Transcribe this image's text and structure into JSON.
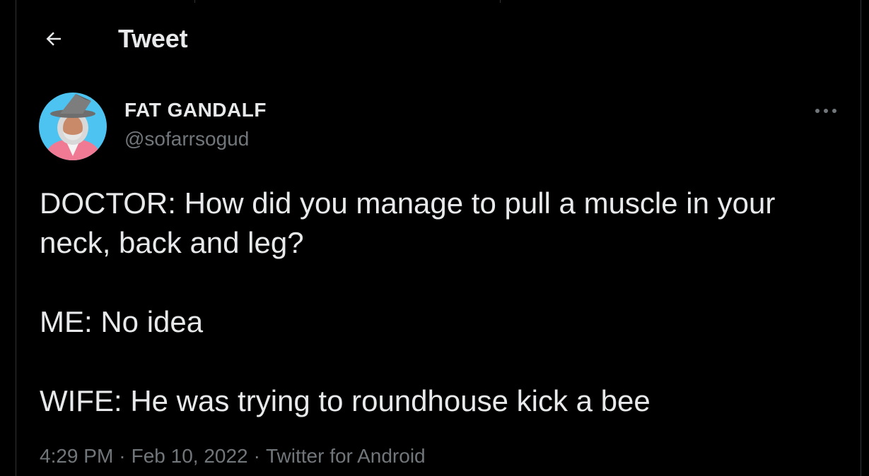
{
  "header": {
    "title": "Tweet",
    "back_icon": "arrow-left-icon"
  },
  "author": {
    "display_name": "FAT GANDALF",
    "handle": "@sofarrsogud",
    "avatar_icon": "avatar-wizard"
  },
  "more_icon": "more-horizontal-icon",
  "tweet": {
    "lines": [
      "DOCTOR: How did you manage to pull a muscle in your neck, back and leg?",
      "ME: No idea",
      "WIFE: He was trying to roundhouse kick a bee"
    ]
  },
  "meta": {
    "time": "4:29 PM",
    "separator": "·",
    "date": "Feb 10, 2022",
    "source": "Twitter for Android"
  },
  "colors": {
    "background": "#000000",
    "text_primary": "#e7e9ea",
    "text_secondary": "#71767b",
    "border": "#2f3336",
    "avatar_bg": "#4cc3f0"
  }
}
